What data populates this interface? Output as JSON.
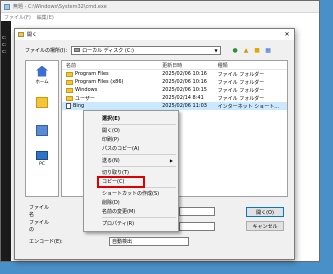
{
  "background_window": {
    "title": "無題 - C:\\Windows\\System32\\cmd.exe",
    "menu": [
      "ファイル(F)",
      "編集(E)"
    ],
    "cmd_lines": [
      "c:",
      "c:",
      "c:"
    ]
  },
  "dialog": {
    "title": "開く",
    "lookin_label": "ファイルの場所(I):",
    "lookin_value": "ローカル ディスク (C:)",
    "toolbar_icons": [
      "back-icon",
      "up-folder-icon",
      "new-folder-icon",
      "view-menu-icon"
    ],
    "places": [
      {
        "label": "ホーム",
        "icon": "home-icon"
      },
      {
        "label": "",
        "icon": "desktop-icon"
      },
      {
        "label": "",
        "icon": "library-icon"
      },
      {
        "label": "PC",
        "icon": "pc-icon"
      }
    ],
    "columns": [
      "名前",
      "更新日時",
      "種類"
    ],
    "rows": [
      {
        "name": "Program Files",
        "date": "2025/02/06 10:16",
        "type": "ファイル フォルダー",
        "icon": "folder"
      },
      {
        "name": "Program Files (x86)",
        "date": "2025/02/06 10:16",
        "type": "ファイル フォルダー",
        "icon": "folder"
      },
      {
        "name": "Windows",
        "date": "2025/02/06 10:15",
        "type": "ファイル フォルダー",
        "icon": "folder"
      },
      {
        "name": "ユーザー",
        "date": "2025/02/14 8:41",
        "type": "ファイル フォルダー",
        "icon": "folder"
      },
      {
        "name": "Bing",
        "date": "2025/02/06 11:03",
        "type": "インターネット ショート...",
        "icon": "shortcut"
      }
    ],
    "filename_label": "ファイル名",
    "filetype_label": "ファイルの",
    "encoding_label": "エンコード(E):",
    "encoding_value": "自動検出",
    "open_button": "開く(O)",
    "cancel_button": "キャンセル"
  },
  "context_menu": {
    "items": [
      {
        "label": "選択(E)",
        "bold": true
      },
      {
        "sep": true
      },
      {
        "label": "開く(O)"
      },
      {
        "label": "印刷(P)"
      },
      {
        "label": "パスのコピー(A)"
      },
      {
        "sep": true
      },
      {
        "label": "送る(N)",
        "submenu": true
      },
      {
        "sep": true
      },
      {
        "label": "切り取り(T)"
      },
      {
        "label": "コピー(C)"
      },
      {
        "sep": true
      },
      {
        "label": "ショートカットの作成(S)"
      },
      {
        "label": "削除(D)"
      },
      {
        "label": "名前の変更(M)"
      },
      {
        "sep": true
      },
      {
        "label": "プロパティ(R)"
      }
    ],
    "highlight_color": "#e00000"
  }
}
